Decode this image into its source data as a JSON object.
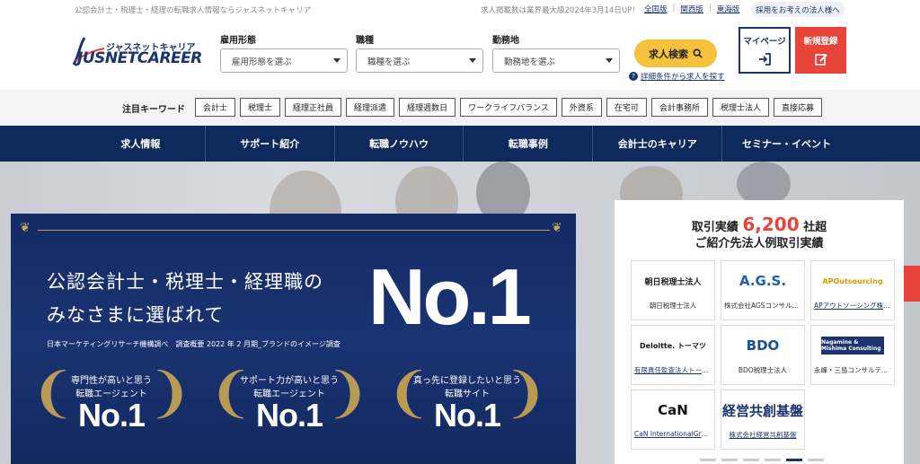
{
  "topbar": {
    "tagline": "公認会計士・税理士・経理の転職求人情報ならジャスネットキャリア",
    "info": "求人掲載数は業界最大級2024年3月14日UP！",
    "links": [
      "全国版",
      "関西版",
      "東海版"
    ],
    "corp_button": "採用をお考えの法人様へ"
  },
  "logo": {
    "sub": "ジャスネットキャリア",
    "main": "JUSNETCAREER"
  },
  "search": {
    "employment": {
      "label": "雇用形態",
      "value": "雇用形態を選ぶ"
    },
    "job": {
      "label": "職種",
      "value": "職種を選ぶ"
    },
    "location": {
      "label": "勤務地",
      "value": "勤務地を選ぶ"
    },
    "button": "求人検索",
    "detail_link": "詳細条件から求人を探す"
  },
  "account": {
    "mypage": "マイページ",
    "register": "新規登録"
  },
  "keywords": {
    "label": "注目キーワード",
    "items": [
      "会計士",
      "税理士",
      "経理正社員",
      "経理派遣",
      "経理週数日",
      "ワークライフバランス",
      "外資系",
      "在宅可",
      "会計事務所",
      "税理士法人",
      "直接応募"
    ]
  },
  "nav": [
    "求人情報",
    "サポート紹介",
    "転職ノウハウ",
    "転職事例",
    "会計士のキャリア",
    "セミナー・イベント"
  ],
  "banner": {
    "headline1": "公認会計士・税理士・経理職の",
    "headline2": "みなさまに選ばれて",
    "big": "No.1",
    "note": "日本マーケティングリサーチ機構調べ　調査概要 2022 年 2 月期_ブランドのイメージ調査",
    "awards": [
      {
        "line1": "専門性が高いと思う",
        "line2": "転職エージェント",
        "rank": "No.1"
      },
      {
        "line1": "サポート力が高いと思う",
        "line2": "転職エージェント",
        "rank": "No.1"
      },
      {
        "line1": "真っ先に登録したいと思う",
        "line2": "転職サイト",
        "rank": "No.1"
      }
    ]
  },
  "results": {
    "title_prefix": "取引実績",
    "count": "6,200",
    "title_suffix": "社超",
    "subtitle": "ご紹介先法人例取引実績",
    "companies": [
      {
        "logo": "朝日税理士法人",
        "name": "朝日税理士法人",
        "link": false,
        "color": "#222"
      },
      {
        "logo": "A.G.S.",
        "name": "株式会社AGSコンサルティング",
        "link": false,
        "color": "#1b5fae"
      },
      {
        "logo": "APOutsourcing",
        "name": "APアウトソーシング株式会社",
        "link": true,
        "color": "#d99a00"
      },
      {
        "logo": "Deloitte. トーマツ",
        "name": "有限責任監査法人トーマツ",
        "link": true,
        "color": "#111"
      },
      {
        "logo": "BDO",
        "name": "BDO税理士法人",
        "link": false,
        "color": "#1b4e9b"
      },
      {
        "logo": "Nagamine & Mishima Consulting",
        "name": "永峰・三島コンサルティング",
        "link": false,
        "color": "#fff"
      },
      {
        "logo": "CaN",
        "name": "CaN InternationalGroup",
        "link": true,
        "color": "#111"
      },
      {
        "logo": "経営共創基盤",
        "name": "株式会社経営共創基盤",
        "link": true,
        "color": "#1b3470"
      }
    ]
  }
}
